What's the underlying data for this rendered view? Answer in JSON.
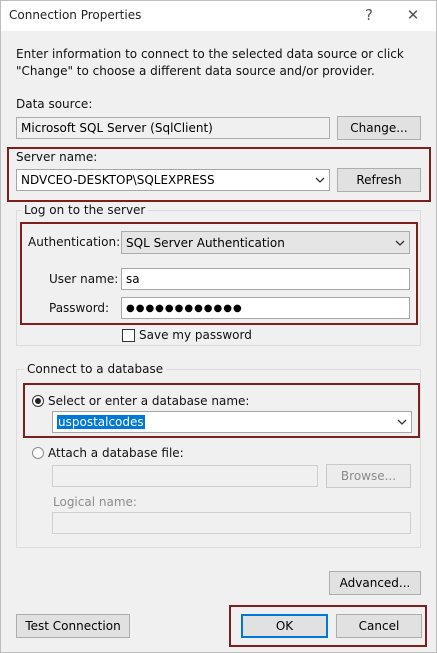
{
  "window": {
    "title": "Connection Properties",
    "help_glyph": "?",
    "close_glyph": "✕"
  },
  "description": "Enter information to connect to the selected data source or click \"Change\" to choose a different data source and/or provider.",
  "data_source": {
    "label": "Data source:",
    "value": "Microsoft SQL Server (SqlClient)",
    "change_button": "Change..."
  },
  "server": {
    "label": "Server name:",
    "value": "NDVCEO-DESKTOP\\SQLEXPRESS",
    "refresh_button": "Refresh"
  },
  "logon": {
    "group_label": "Log on to the server",
    "auth_label": "Authentication:",
    "auth_value": "SQL Server Authentication",
    "username_label": "User name:",
    "username_value": "sa",
    "password_label": "Password:",
    "password_mask": "●●●●●●●●●●●●",
    "save_password_label": "Save my password",
    "save_password_checked": false
  },
  "database": {
    "group_label": "Connect to a database",
    "select_option_label": "Select or enter a database name:",
    "select_option_selected": true,
    "database_value": "uspostalcodes",
    "attach_option_label": "Attach a database file:",
    "attach_file_value": "",
    "browse_button": "Browse...",
    "logical_name_label": "Logical name:",
    "logical_name_value": ""
  },
  "buttons": {
    "advanced": "Advanced...",
    "test_connection": "Test Connection",
    "ok": "OK",
    "cancel": "Cancel"
  },
  "colors": {
    "highlight_border": "#7b1f1f",
    "accent": "#0078d7",
    "background": "#f0f0f0"
  },
  "icons": {
    "dropdown": "chevron-down-icon"
  }
}
